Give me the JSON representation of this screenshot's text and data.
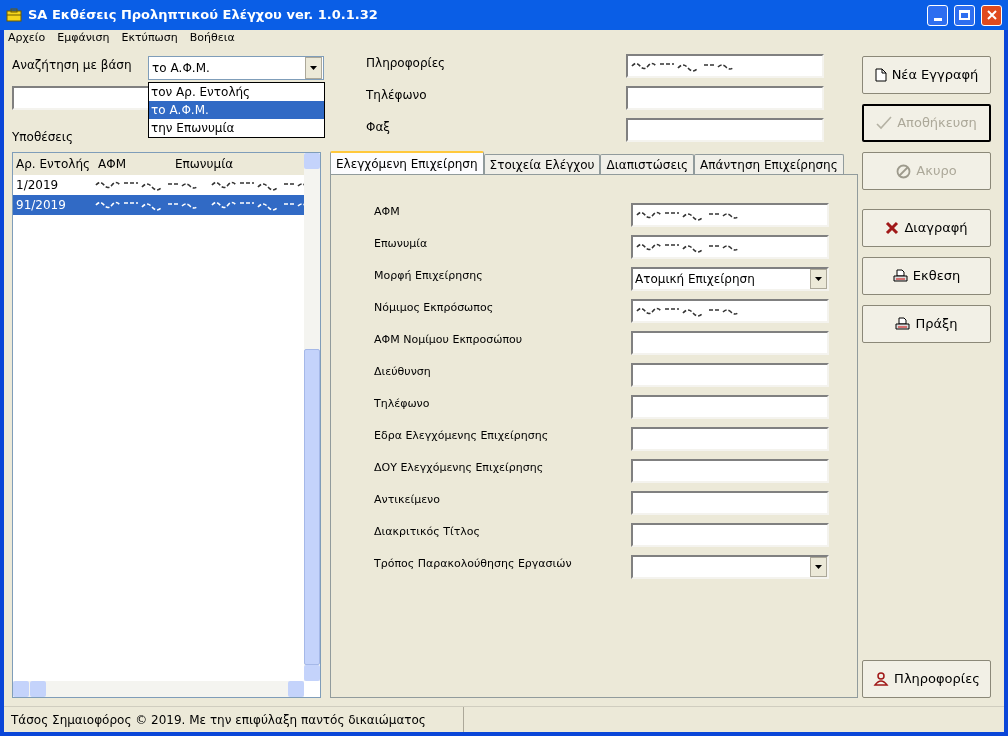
{
  "window": {
    "title": "SA Εκθέσεις Προληπτικού Ελέγχου ver. 1.0.1.32"
  },
  "menu": [
    "Αρχείο",
    "Εμφάνιση",
    "Εκτύπωση",
    "Βοήθεια"
  ],
  "search": {
    "label": "Αναζήτηση με βάση",
    "value": "το Α.Φ.Μ.",
    "expanded": true,
    "options": [
      {
        "label": "τον Αρ. Εντολής",
        "selected": false
      },
      {
        "label": "το Α.Φ.Μ.",
        "selected": true
      },
      {
        "label": "την Επωνυμία",
        "selected": false
      }
    ]
  },
  "cases": {
    "label": "Υποθέσεις",
    "columns": [
      "Αρ. Εντολής",
      "ΑΦΜ",
      "Επωνυμία"
    ],
    "rows": [
      {
        "number": "1/2019",
        "redacted": true,
        "selected": false
      },
      {
        "number": "91/2019",
        "redacted": true,
        "selected": true
      }
    ]
  },
  "info_fields": [
    {
      "label": "Πληροφορίες",
      "redacted": true
    },
    {
      "label": "Τηλέφωνο",
      "redacted": false
    },
    {
      "label": "Φαξ",
      "redacted": false
    }
  ],
  "tabs": [
    {
      "label": "Ελεγχόμενη Επιχείρηση",
      "selected": true
    },
    {
      "label": "Στοιχεία Ελέγχου",
      "selected": false
    },
    {
      "label": "Διαπιστώσεις",
      "selected": false
    },
    {
      "label": "Απάντηση Επιχείρησης",
      "selected": false
    }
  ],
  "form_fields": [
    {
      "label": "ΑΦΜ",
      "kind": "text",
      "redacted": true
    },
    {
      "label": "Επωνυμία",
      "kind": "text",
      "redacted": true
    },
    {
      "label": "Μορφή Επιχείρησης",
      "kind": "combo",
      "value": "Ατομική Επιχείρηση"
    },
    {
      "label": "Νόμιμος Εκπρόσωπος",
      "kind": "text",
      "redacted": true
    },
    {
      "label": "ΑΦΜ Νομίμου Εκπροσώπου",
      "kind": "text",
      "redacted": false
    },
    {
      "label": "Διεύθυνση",
      "kind": "text",
      "redacted": false
    },
    {
      "label": "Τηλέφωνο",
      "kind": "text",
      "redacted": false
    },
    {
      "label": "Εδρα Ελεγχόμενης Επιχείρησης",
      "kind": "text",
      "redacted": false
    },
    {
      "label": "ΔΟΥ Ελεγχόμενης Επιχείρησης",
      "kind": "text",
      "redacted": false
    },
    {
      "label": "Αντικείμενο",
      "kind": "text",
      "redacted": false
    },
    {
      "label": "Διακριτικός Τίτλος",
      "kind": "text",
      "redacted": false
    },
    {
      "label": "Τρόπος Παρακολούθησης Εργασιών",
      "kind": "combo"
    }
  ],
  "buttons": [
    {
      "label": "Νέα Εγγραφή",
      "kind": "new",
      "disabled": false
    },
    {
      "label": "Αποθήκευση",
      "kind": "save",
      "disabled": true
    },
    {
      "label": "Ακυρο",
      "kind": "cancel",
      "disabled": true
    },
    {
      "label": "Διαγραφή",
      "kind": "delete",
      "disabled": false
    },
    {
      "label": "Εκθεση",
      "kind": "print",
      "disabled": false
    },
    {
      "label": "Πράξη",
      "kind": "print",
      "disabled": false
    }
  ],
  "info_button": {
    "label": "Πληροφορίες"
  },
  "status_bar": {
    "text": "Τάσος Σημαιοφόρος © 2019. Με την επιφύλαξη παντός δικαιώματος"
  }
}
